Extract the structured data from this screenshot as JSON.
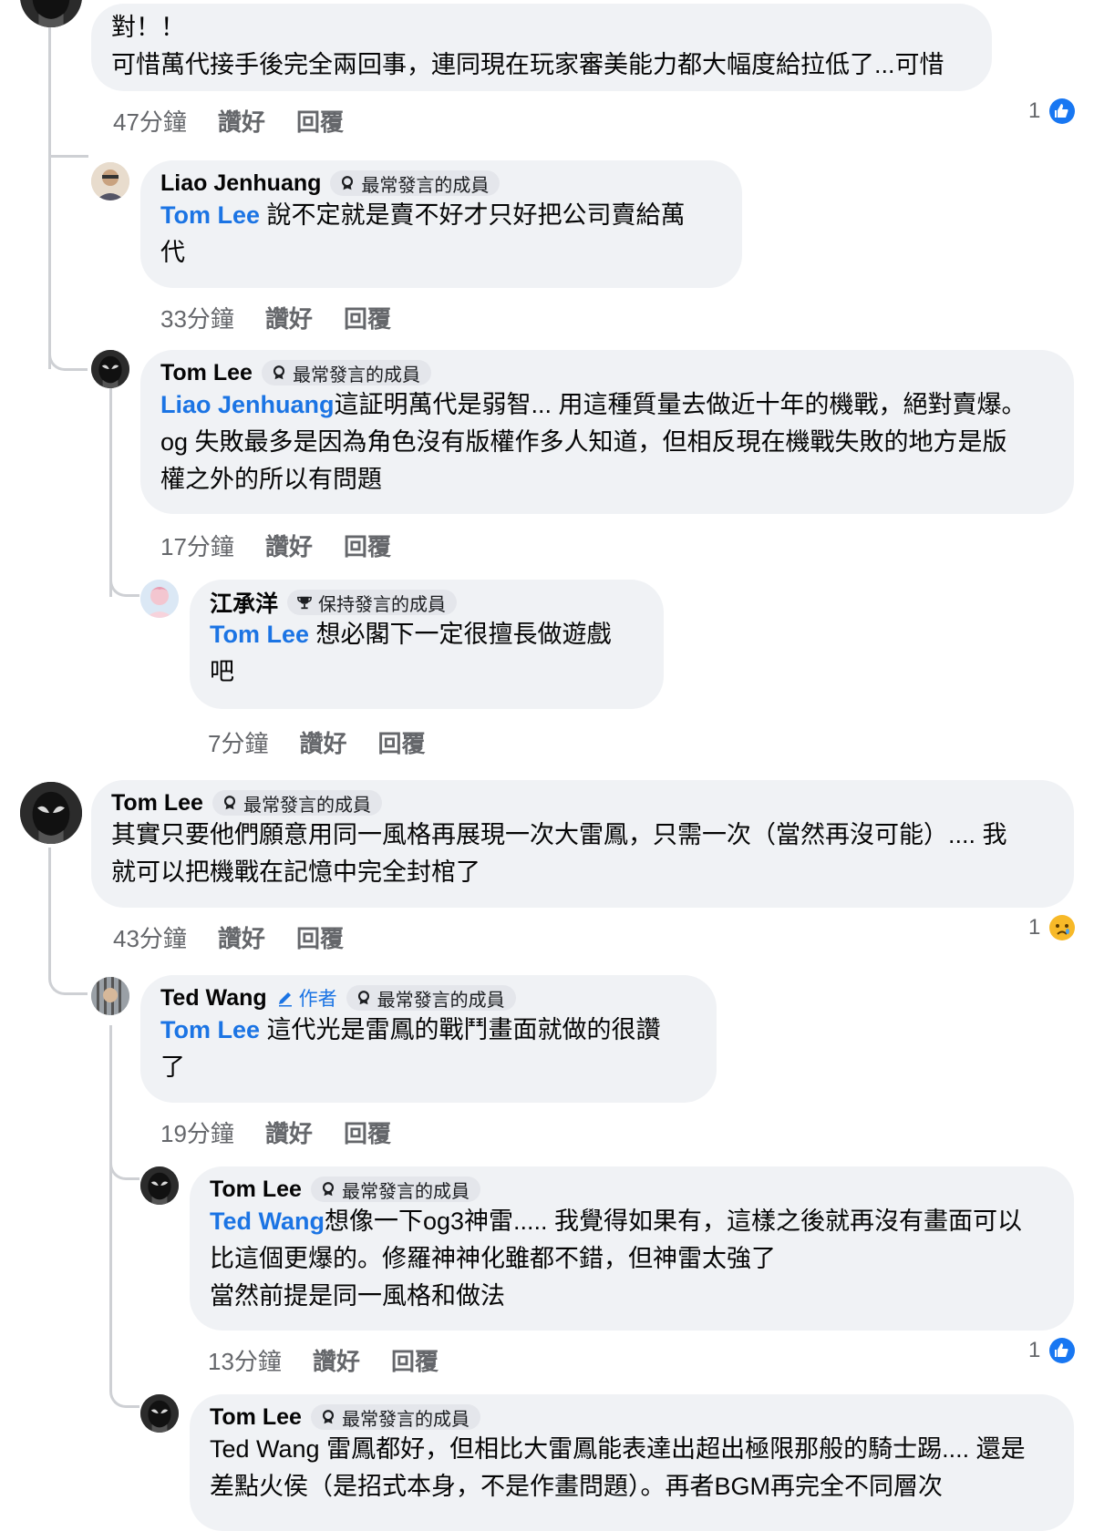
{
  "badges": {
    "top_contributor": "最常發言的成員",
    "rising_contributor": "保持發言的成員",
    "author": "作者"
  },
  "actions": {
    "like": "讚好",
    "reply": "回覆"
  },
  "comments": [
    {
      "id": "c0",
      "text_line1": "對！！",
      "text_line2": "可惜萬代接手後完全兩回事，連同現在玩家審美能力都大幅度給拉低了...可惜",
      "time": "47分鐘",
      "reaction_count": "1",
      "reaction_icon": "like-icon"
    },
    {
      "id": "c1",
      "name": "Liao Jenhuang",
      "badge": "最常發言的成員",
      "mention": "Tom Lee",
      "text": " 說不定就是賣不好才只好把公司賣給萬\n代",
      "time": "33分鐘"
    },
    {
      "id": "c2",
      "name": "Tom Lee",
      "badge": "最常發言的成員",
      "mention": "Liao Jenhuang",
      "text": "這証明萬代是弱智... 用這種質量去做近十年的機戰，絕對賣爆。\nog 失敗最多是因為角色沒有版權作多人知道，但相反現在機戰失敗的地方是版\n權之外的所以有問題",
      "time": "17分鐘"
    },
    {
      "id": "c3",
      "name": "江承洋",
      "badge": "保持發言的成員",
      "mention": "Tom Lee",
      "text": " 想必閣下一定很擅長做遊戲\n吧",
      "time": "7分鐘"
    },
    {
      "id": "c4",
      "name": "Tom Lee",
      "badge": "最常發言的成員",
      "text": "其實只要他們願意用同一風格再展現一次大雷鳳，只需一次（當然再沒可能）.... 我\n就可以把機戰在記憶中完全封棺了",
      "time": "43分鐘",
      "reaction_count": "1",
      "reaction_icon": "sad-icon"
    },
    {
      "id": "c5",
      "name": "Ted Wang",
      "author_tag": "作者",
      "badge": "最常發言的成員",
      "mention": "Tom Lee",
      "text": " 這代光是雷鳳的戰鬥畫面就做的很讚\n了",
      "time": "19分鐘"
    },
    {
      "id": "c6",
      "name": "Tom Lee",
      "badge": "最常發言的成員",
      "mention": "Ted Wang",
      "text": "想像一下og3神雷..... 我覺得如果有，這樣之後就再沒有畫面可以\n比這個更爆的。修羅神神化雖都不錯，但神雷太強了\n當然前提是同一風格和做法",
      "time": "13分鐘",
      "reaction_count": "1",
      "reaction_icon": "like-icon"
    },
    {
      "id": "c7",
      "name": "Tom Lee",
      "badge": "最常發言的成員",
      "text": "Ted Wang 雷鳳都好，但相比大雷鳳能表達出超出極限那般的騎士踢.... 還是\n差點火侯（是招式本身，不是作畫問題）。再者BGM再完全不同層次"
    }
  ]
}
